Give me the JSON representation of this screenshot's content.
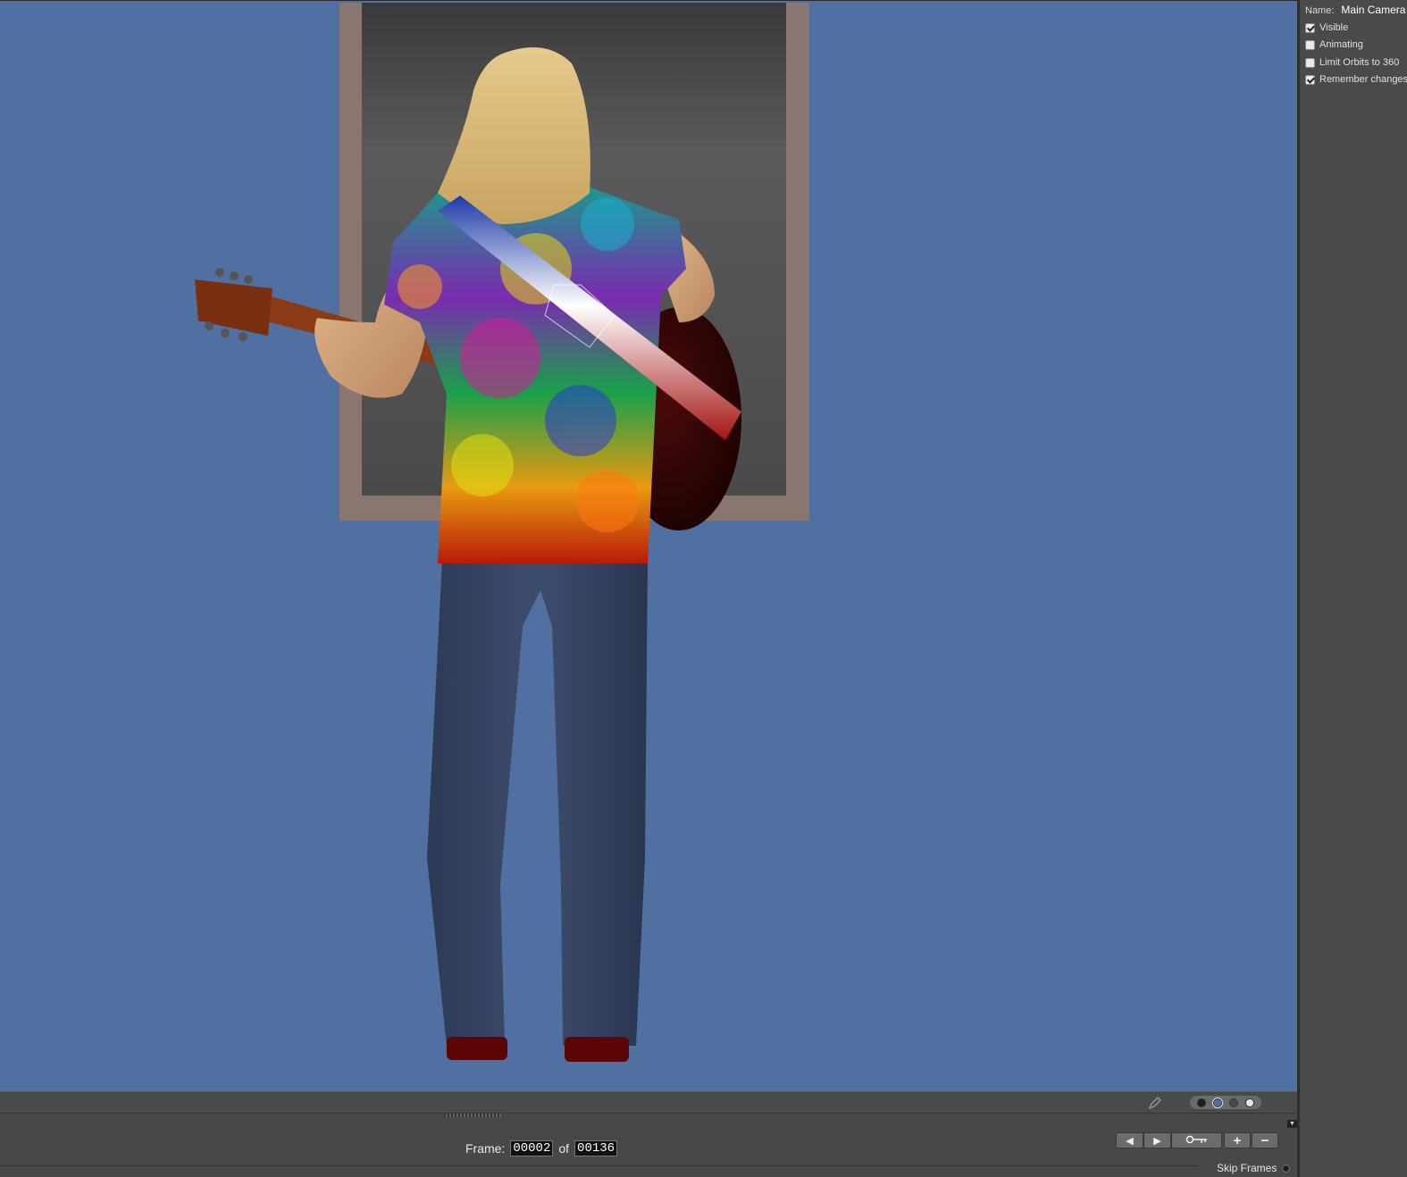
{
  "camera_panel": {
    "name_label": "Name:",
    "name_value": "Main Camera",
    "options": [
      {
        "label": "Visible",
        "checked": true
      },
      {
        "label": "Animating",
        "checked": false
      },
      {
        "label": "Limit Orbits to 360",
        "checked": false
      },
      {
        "label": "Remember changes",
        "checked": true
      }
    ]
  },
  "viewport": {
    "background_color": "#5070a1",
    "display_swatches": [
      "#1e1e1e",
      "#5070a1",
      "#4a4a4a",
      "#e8e8e8"
    ],
    "selected_swatch": 1
  },
  "timeline": {
    "frame_label": "Frame:",
    "current_frame": "00002",
    "of_label": "of",
    "total_frames": "00136",
    "buttons": {
      "prev": "◀",
      "next": "▶",
      "key": "key-icon",
      "add": "+",
      "remove": "−"
    },
    "skip_frames_label": "Skip Frames"
  }
}
